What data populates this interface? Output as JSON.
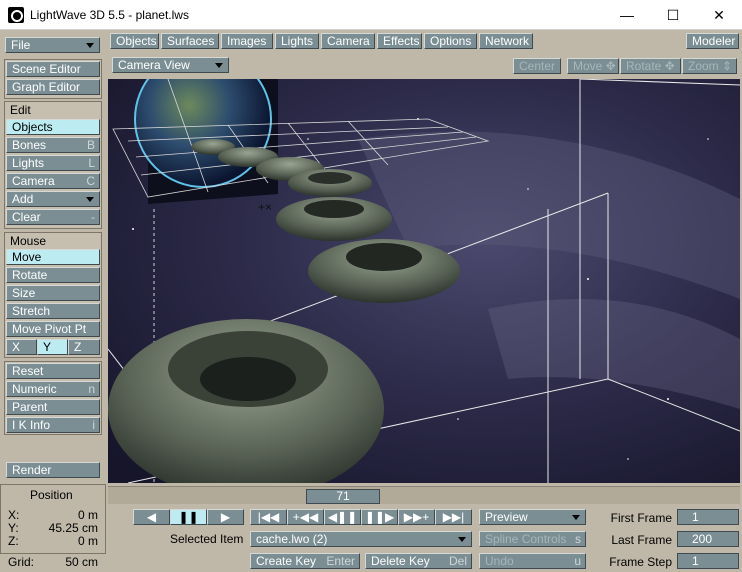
{
  "window": {
    "title": "LightWave 3D 5.5 - planet.lws",
    "minimize": "—",
    "maximize": "☐",
    "close": "✕"
  },
  "menu": {
    "tabs": [
      "Objects",
      "Surfaces",
      "Images",
      "Lights",
      "Camera",
      "Effects",
      "Options",
      "Network"
    ],
    "modeler": "Modeler"
  },
  "sidebar": {
    "file": "File",
    "scene_editor": "Scene Editor",
    "graph_editor": "Graph Editor",
    "edit_label": "Edit",
    "objects": "Objects",
    "bones": "Bones",
    "bones_key": "B",
    "lights": "Lights",
    "lights_key": "L",
    "camera": "Camera",
    "camera_key": "C",
    "add": "Add",
    "clear": "Clear",
    "clear_key": "-",
    "mouse_label": "Mouse",
    "move": "Move",
    "rotate": "Rotate",
    "size": "Size",
    "stretch": "Stretch",
    "move_pivot": "Move Pivot Pt",
    "x": "X",
    "y": "Y",
    "z": "Z",
    "reset": "Reset",
    "numeric": "Numeric",
    "numeric_key": "n",
    "parent": "Parent",
    "ik_info": "I K Info",
    "ik_key": "i",
    "render": "Render"
  },
  "view": {
    "mode": "Camera View",
    "center": "Center",
    "move": "Move ✥",
    "rotate": "Rotate ✥",
    "zoom": "Zoom ⇕"
  },
  "position": {
    "title": "Position",
    "x_label": "X:",
    "x_val": "0 m",
    "y_label": "Y:",
    "y_val": "45.25 cm",
    "z_label": "Z:",
    "z_val": "0 m",
    "grid_label": "Grid:",
    "grid_val": "50 cm"
  },
  "timeline": {
    "current_frame": "71"
  },
  "transport": {
    "prev": "◀",
    "pause": "❚❚",
    "play": "▶",
    "first": "|◀◀",
    "prev_key": "+◀◀",
    "step_back": "◀❚❚",
    "step_fwd": "❚❚▶",
    "next_key": "▶▶+",
    "last": "▶▶|"
  },
  "controls": {
    "selected_item_label": "Selected Item",
    "selected_item": "cache.lwo (2)",
    "preview": "Preview",
    "spline_controls": "Spline Controls",
    "spline_key": "s",
    "create_key": "Create Key",
    "create_key_hint": "Enter",
    "delete_key": "Delete Key",
    "delete_key_hint": "Del",
    "undo": "Undo",
    "undo_key": "u",
    "first_frame_label": "First Frame",
    "first_frame": "1",
    "last_frame_label": "Last Frame",
    "last_frame": "200",
    "frame_step_label": "Frame Step",
    "frame_step": "1"
  },
  "colors": {
    "button": "#7a8e94",
    "active_button": "#bcecf2",
    "panel": "#bfb8a9",
    "viewport_bg": "#1d1c2e"
  }
}
